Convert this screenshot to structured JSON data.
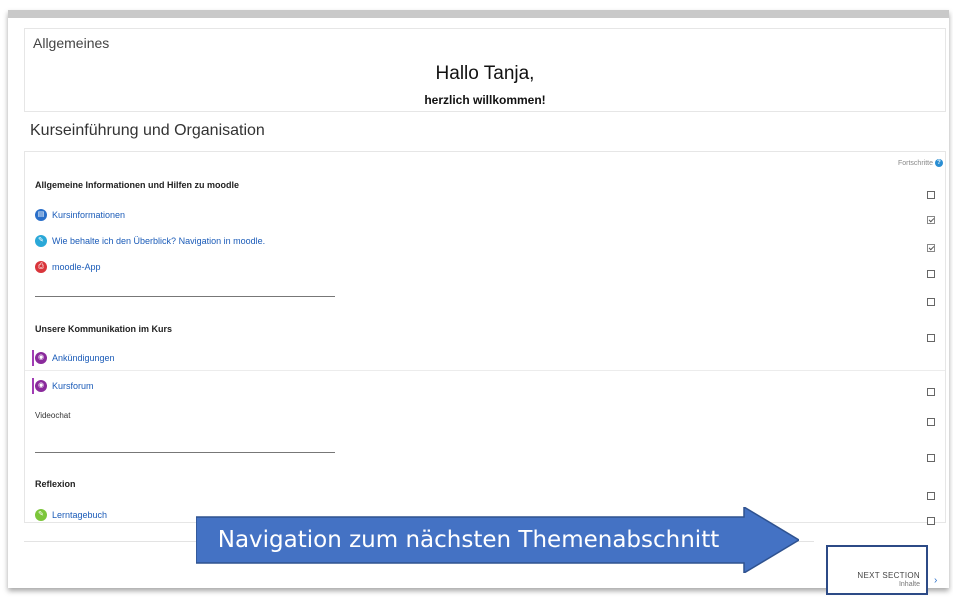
{
  "general": {
    "section_title": "Allgemeines",
    "greeting": "Hallo Tanja,",
    "welcome": "herzlich willkommen!"
  },
  "course_section": {
    "title": "Kurseinführung und Organisation",
    "progress_label": "Fortschritte",
    "help_icon_glyph": "?",
    "block1_heading": "Allgemeine Informationen und Hilfen zu moodle",
    "activities1": [
      {
        "label": "Kursinformationen",
        "icon": "book-icon",
        "glyph": "▤",
        "checked": true
      },
      {
        "label": "Wie behalte ich den Überblick? Navigation in moodle.",
        "icon": "pencil-icon",
        "glyph": "✎",
        "checked": true
      },
      {
        "label": "moodle-App",
        "icon": "pdf-icon",
        "glyph": "⎙",
        "checked": false
      }
    ],
    "block2_heading": "Unsere Kommunikation im Kurs",
    "activities2": [
      {
        "label": "Ankündigungen",
        "icon": "forum-icon",
        "glyph": "◉"
      },
      {
        "label": "Kursforum",
        "icon": "forum-icon",
        "glyph": "◉"
      }
    ],
    "videochat": "Videochat",
    "block3_heading": "Reflexion",
    "activities3": [
      {
        "label": "Lerntagebuch",
        "icon": "journal-icon",
        "glyph": "✎",
        "checked": false
      }
    ]
  },
  "callout": {
    "text": "Navigation zum nächsten Themenabschnitt",
    "color": "#4472c4",
    "border_color": "#2f528f"
  },
  "next_section": {
    "label": "NEXT SECTION",
    "sublabel": "Inhalte",
    "chevron": "›"
  }
}
